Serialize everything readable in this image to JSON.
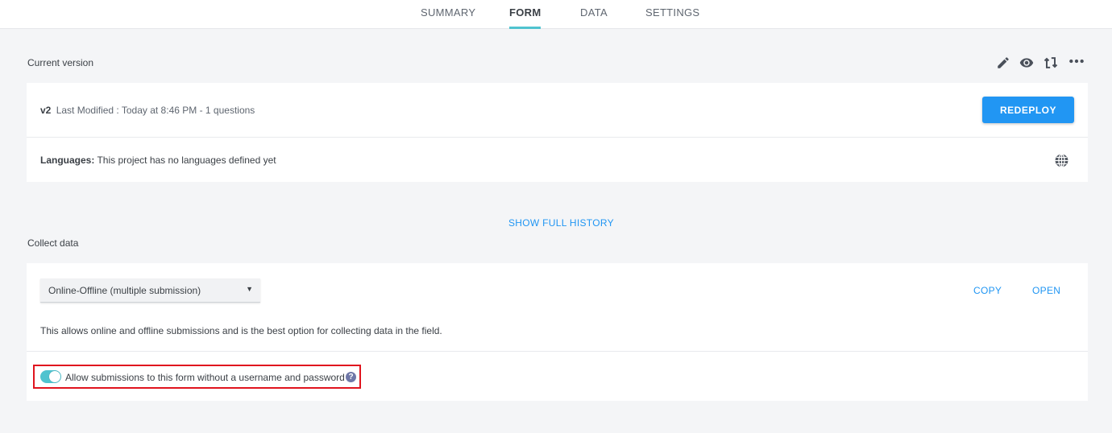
{
  "tabs": [
    {
      "label": "SUMMARY",
      "active": false
    },
    {
      "label": "FORM",
      "active": true
    },
    {
      "label": "DATA",
      "active": false
    },
    {
      "label": "SETTINGS",
      "active": false
    }
  ],
  "current_version": {
    "section_label": "Current version",
    "version": "v2",
    "modified_text": "Last Modified : Today at 8:46 PM - 1 questions",
    "redeploy_label": "REDEPLOY",
    "languages_label": "Languages:",
    "languages_text": "This project has no languages defined yet",
    "icons": [
      "pencil-icon",
      "eye-icon",
      "sync-arrows-icon",
      "more-dots-icon",
      "globe-icon"
    ]
  },
  "history": {
    "link_label": "SHOW FULL HISTORY"
  },
  "collect_data": {
    "section_label": "Collect data",
    "selected_option": "Online-Offline (multiple submission)",
    "copy_label": "COPY",
    "open_label": "OPEN",
    "description": "This allows online and offline submissions and is the best option for collecting data in the field.",
    "toggle_label": "Allow submissions to this form without a username and password",
    "toggle_on": true,
    "help_glyph": "?"
  },
  "colors": {
    "accent": "#4fc3cf",
    "primary_button": "#2196f3",
    "link": "#2196f3",
    "highlight": "#e0141e",
    "help_icon": "#6f78a8"
  }
}
